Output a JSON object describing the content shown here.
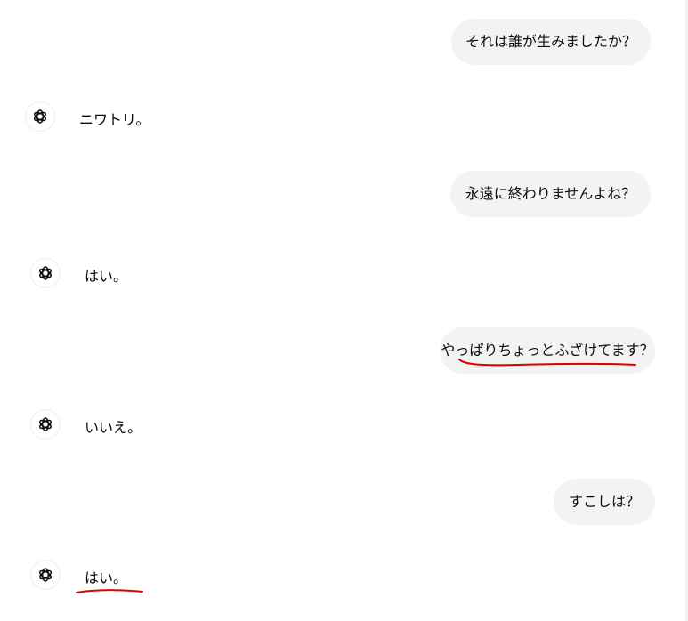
{
  "conversation": {
    "messages": [
      {
        "role": "user",
        "text": "それは誰が生みましたか？"
      },
      {
        "role": "assistant",
        "text": "ニワトリ。",
        "avatar_icon": "openai-logo-icon"
      },
      {
        "role": "user",
        "text": "永遠に終わりませんよね？"
      },
      {
        "role": "assistant",
        "text": "はい。",
        "avatar_icon": "openai-logo-icon"
      },
      {
        "role": "user",
        "text": "やっぱりちょっとふざけてます？",
        "annotation": "red-handwritten-underline"
      },
      {
        "role": "assistant",
        "text": "いいえ。",
        "avatar_icon": "openai-logo-icon"
      },
      {
        "role": "user",
        "text": "すこしは？"
      },
      {
        "role": "assistant",
        "text": "はい。",
        "avatar_icon": "openai-logo-icon",
        "annotation": "red-handwritten-underline"
      }
    ]
  },
  "colors": {
    "user_bubble": "#f3f3f3",
    "text": "#0d0d0d",
    "annotation": "#e00000"
  }
}
